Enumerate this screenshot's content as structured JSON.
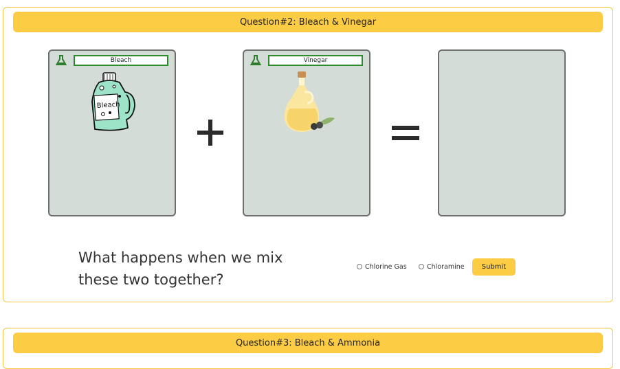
{
  "question2": {
    "title": "Question#2: Bleach & Vinegar",
    "card1_label": "Bleach",
    "card1_image_text": "Bleach",
    "card2_label": "Vinegar",
    "prompt": "What happens when we mix these two together?",
    "options": [
      "Chlorine Gas",
      "Chloramine"
    ],
    "submit_label": "Submit"
  },
  "question3": {
    "title": "Question#3: Bleach & Ammonia"
  },
  "icons": {
    "card_icon": "flask-icon",
    "plus": "plus-icon",
    "equals": "equals-icon"
  },
  "colors": {
    "accent": "#fccc45",
    "card_bg": "#d4dcd7",
    "label_border": "#2e8b2e"
  }
}
